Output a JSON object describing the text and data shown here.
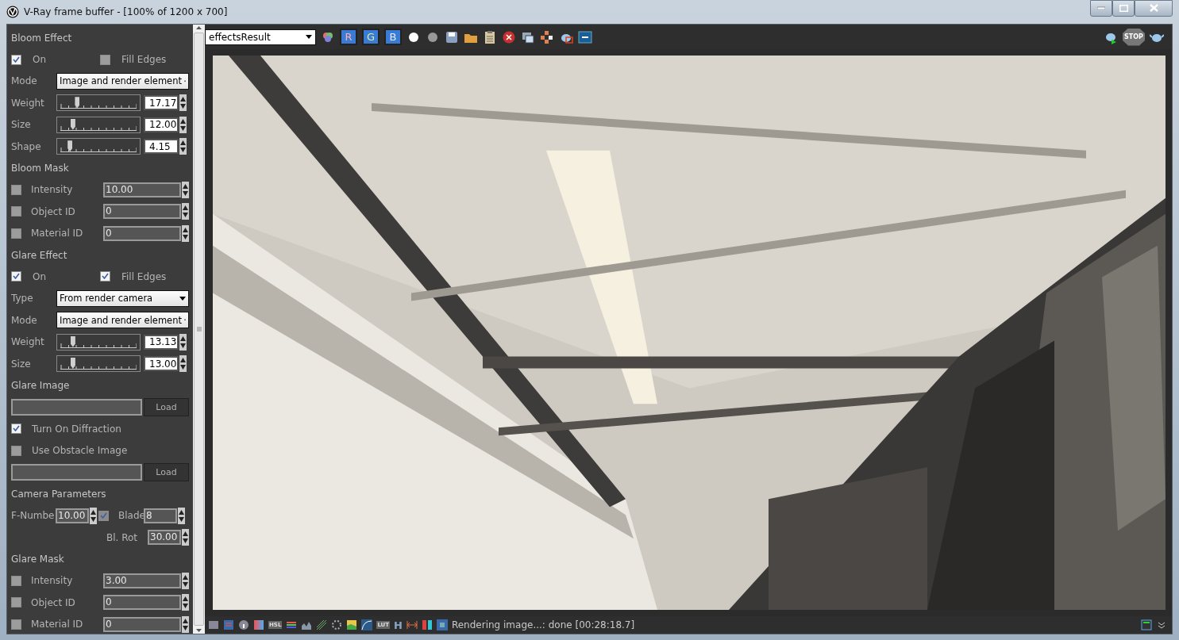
{
  "window": {
    "title": "V-Ray frame buffer - [100% of 1200 x 700]"
  },
  "panel": {
    "rows": [
      {
        "kind": "heading",
        "text": "Bloom Effect"
      },
      {
        "kind": "checks",
        "items": [
          {
            "label": "On",
            "checked": true
          },
          {
            "label": "Fill Edges",
            "checked": false
          }
        ]
      },
      {
        "kind": "dropdown",
        "label": "Mode",
        "value": "Image and render element"
      },
      {
        "kind": "slider",
        "label": "Weight",
        "level": 0.2,
        "value": "17.17"
      },
      {
        "kind": "slider",
        "label": "Size",
        "level": 0.14,
        "value": "12.00"
      },
      {
        "kind": "slider",
        "label": "Shape",
        "level": 0.1,
        "value": "4.15"
      },
      {
        "kind": "heading",
        "text": "Bloom Mask"
      },
      {
        "kind": "mask",
        "label": "Intensity",
        "checked": false,
        "value": "10.00"
      },
      {
        "kind": "mask",
        "label": "Object ID",
        "checked": false,
        "value": "0"
      },
      {
        "kind": "mask",
        "label": "Material ID",
        "checked": false,
        "value": "0"
      },
      {
        "kind": "heading",
        "text": "Glare Effect"
      },
      {
        "kind": "checks",
        "items": [
          {
            "label": "On",
            "checked": true
          },
          {
            "label": "Fill Edges",
            "checked": true
          }
        ]
      },
      {
        "kind": "dropdown",
        "label": "Type",
        "value": "From render camera"
      },
      {
        "kind": "dropdown",
        "label": "Mode",
        "value": "Image and render element"
      },
      {
        "kind": "slider",
        "label": "Weight",
        "level": 0.14,
        "value": "13.13"
      },
      {
        "kind": "slider",
        "label": "Size",
        "level": 0.14,
        "value": "13.00"
      },
      {
        "kind": "heading",
        "text": "Glare Image"
      },
      {
        "kind": "file",
        "button": "Load"
      },
      {
        "kind": "check",
        "label": "Turn On Diffraction",
        "checked": true
      },
      {
        "kind": "check",
        "label": "Use Obstacle Image",
        "checked": false
      },
      {
        "kind": "file",
        "button": "Load"
      },
      {
        "kind": "heading",
        "text": "Camera Parameters"
      },
      {
        "kind": "camera",
        "label": "F-Numbe",
        "value": "10.00",
        "checked": true,
        "disabled": true,
        "label2": "Blade",
        "value2": "8"
      },
      {
        "kind": "rot",
        "label": "Bl. Rot",
        "value": "30.00"
      },
      {
        "kind": "heading",
        "text": "Glare Mask"
      },
      {
        "kind": "mask",
        "label": "Intensity",
        "checked": false,
        "value": "3.00"
      },
      {
        "kind": "mask",
        "label": "Object ID",
        "checked": false,
        "value": "0"
      },
      {
        "kind": "mask",
        "label": "Material ID",
        "checked": false,
        "value": "0"
      }
    ]
  },
  "toolbar": {
    "channel_select": "effectsResult",
    "channels": [
      {
        "label": "R",
        "selected": true
      },
      {
        "label": "G",
        "selected": true
      },
      {
        "label": "B",
        "selected": true
      }
    ],
    "stop_label": "STOP"
  },
  "status_bar": {
    "hsl_label": "HSL",
    "lut_label": "LUT",
    "h_label": "H",
    "text": "Rendering image...: done [00:28:18.7]"
  }
}
